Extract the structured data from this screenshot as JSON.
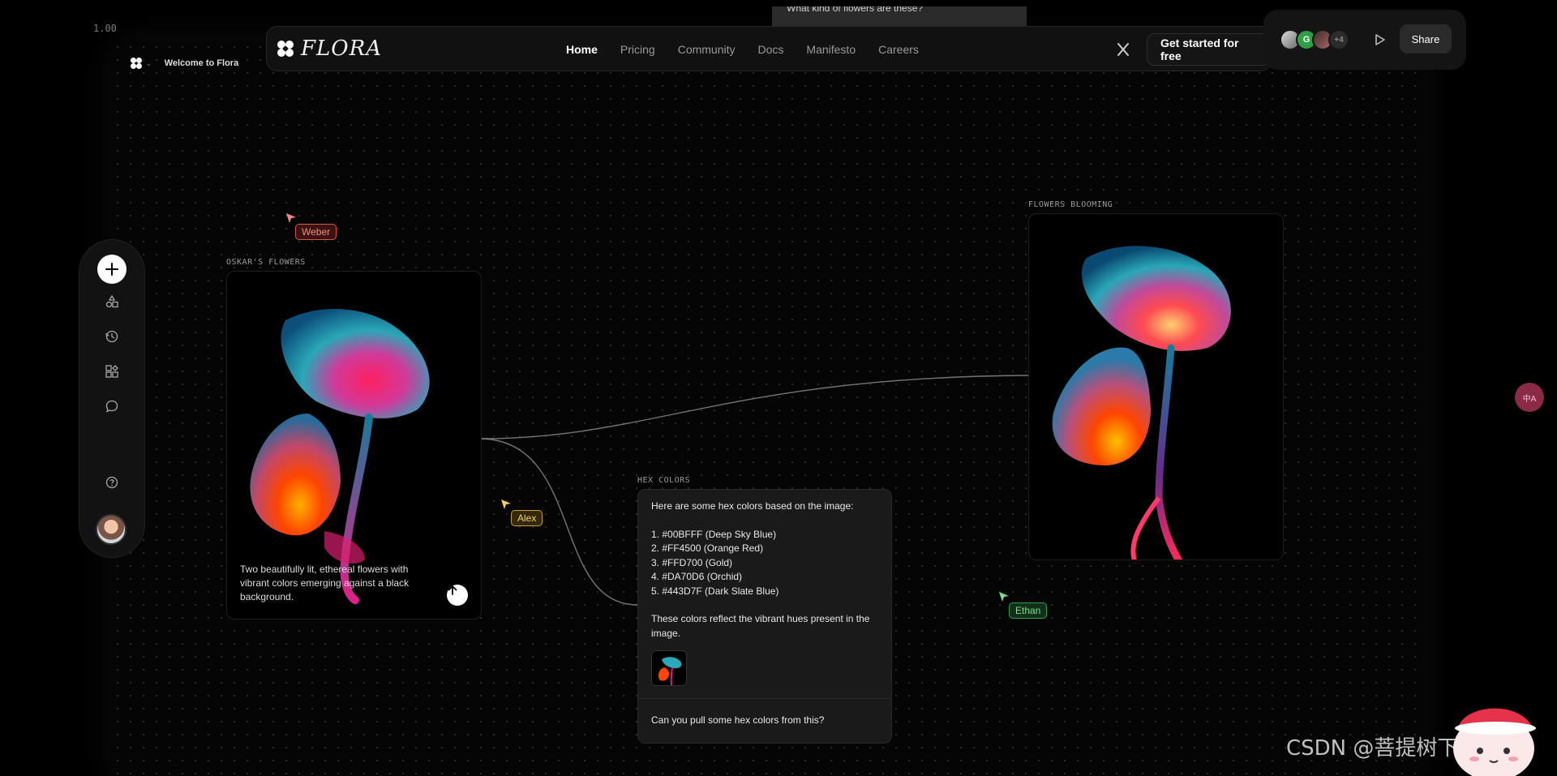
{
  "zoom": "1.00",
  "canvas": {
    "welcome": "Welcome to Flora"
  },
  "prompt_snippet": "What kind of flowers are these?",
  "nav": {
    "brand": "FLORA",
    "links": [
      "Home",
      "Pricing",
      "Community",
      "Docs",
      "Manifesto",
      "Careers"
    ],
    "active": "Home",
    "cta": "Get started for free"
  },
  "collab": {
    "avatar_initial": "G",
    "more_count": "+4",
    "share": "Share"
  },
  "cursors": {
    "weber": "Weber",
    "alex": "Alex",
    "ethan": "Ethan"
  },
  "nodes": {
    "oskars_flowers": {
      "label": "OSKAR'S FLOWERS",
      "caption": "Two beautifully lit, ethereal flowers with vibrant colors emerging against a black background."
    },
    "flowers_blooming": {
      "label": "FLOWERS BLOOMING"
    },
    "hex_colors": {
      "label": "HEX COLORS",
      "intro": "Here are some hex colors based on the image:",
      "colors": [
        "1. #00BFFF (Deep Sky Blue)",
        "2. #FF4500 (Orange Red)",
        "3. #FFD700 (Gold)",
        "4. #DA70D6 (Orchid)",
        "5. #443D7F (Dark Slate Blue)"
      ],
      "outro": "These colors reflect the vibrant hues present in the image.",
      "question": "Can you pull some hex colors from this?"
    }
  },
  "translate": "中A",
  "watermark": "CSDN @菩提树下呀",
  "colors": {
    "weber": "#d9534f",
    "alex": "#c9a227",
    "ethan": "#2ea043"
  }
}
